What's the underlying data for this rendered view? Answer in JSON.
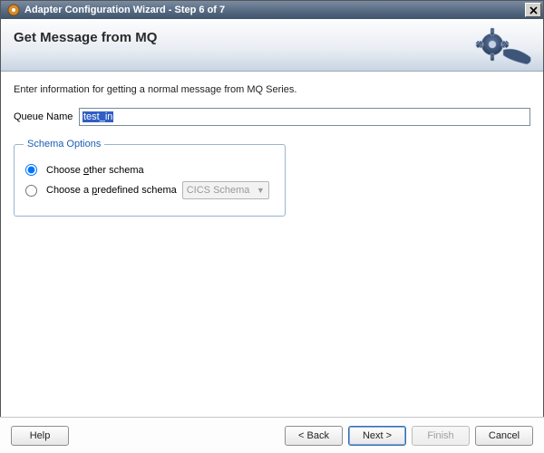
{
  "window": {
    "title": "Adapter Configuration Wizard - Step 6 of 7"
  },
  "banner": {
    "heading": "Get Message from MQ"
  },
  "intro_text": "Enter information for getting a normal message from MQ Series.",
  "queue": {
    "label": "Queue Name",
    "value": "test_in"
  },
  "schema": {
    "legend": "Schema Options",
    "options": [
      {
        "id": "other",
        "label_pre": "Choose ",
        "accel": "o",
        "label_post": "ther schema",
        "selected": true
      },
      {
        "id": "predefined",
        "label_pre": "Choose a ",
        "accel": "p",
        "label_post": "redefined schema",
        "selected": false
      }
    ],
    "predefined_combo": {
      "value": "CICS Schema",
      "enabled": false
    }
  },
  "buttons": {
    "help": "Help",
    "back": "< Back",
    "next": "Next >",
    "finish": "Finish",
    "cancel": "Cancel",
    "finish_enabled": false
  }
}
